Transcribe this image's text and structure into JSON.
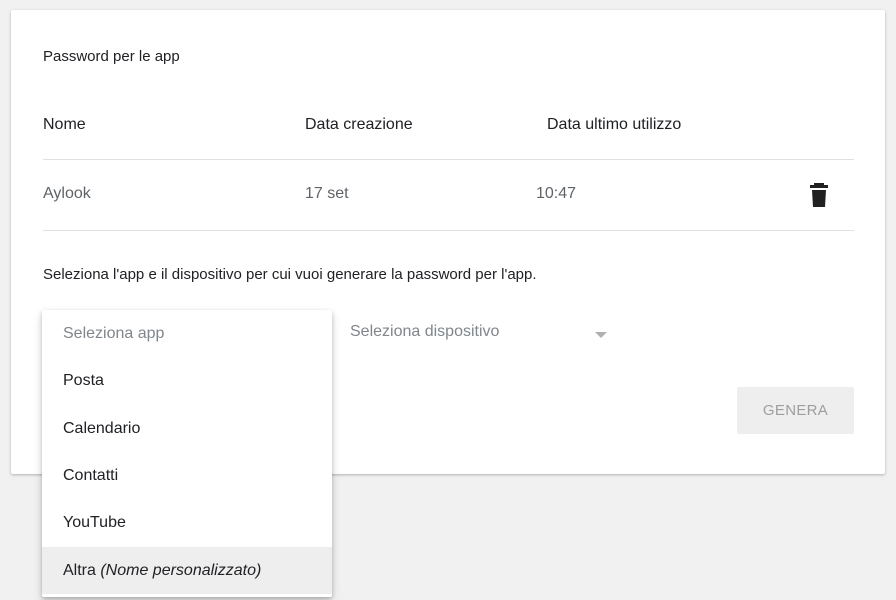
{
  "card": {
    "title": "Password per le app",
    "columns": {
      "name": "Nome",
      "created": "Data creazione",
      "last_used": "Data ultimo utilizzo"
    },
    "rows": [
      {
        "name": "Aylook",
        "created": "17 set",
        "last_used": "10:47",
        "action_icon": "trash-icon"
      }
    ],
    "instruction": "Seleziona l'app e il dispositivo per cui vuoi generare la password per l'app.",
    "device_select": {
      "placeholder": "Seleziona dispositivo",
      "icon": "chevron-down-icon"
    },
    "generate_label": "GENERA"
  },
  "app_dropdown": {
    "placeholder": "Seleziona app",
    "options": [
      {
        "label": "Posta"
      },
      {
        "label": "Calendario"
      },
      {
        "label": "Contatti"
      },
      {
        "label": "YouTube"
      },
      {
        "label": "Altra",
        "note": "(Nome personalizzato)",
        "highlighted": true
      }
    ]
  },
  "colors": {
    "background": "#f1f1f1",
    "card": "#ffffff",
    "text_primary": "#202124",
    "text_secondary": "#5f6368",
    "placeholder": "#80868b",
    "disabled_button_bg": "#eeeeee",
    "disabled_button_text": "#9e9e9e",
    "highlight": "#eeeeee"
  }
}
